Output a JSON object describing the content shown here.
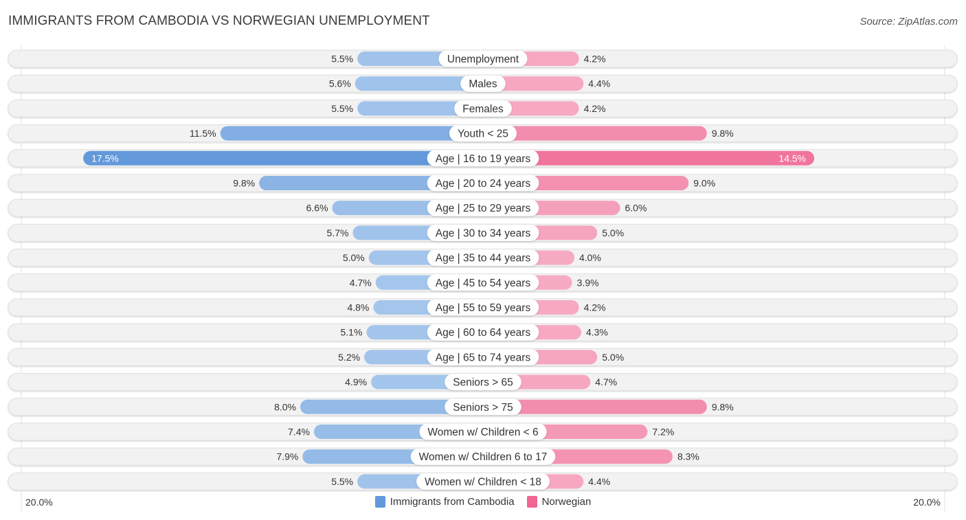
{
  "header": {
    "title": "IMMIGRANTS FROM CAMBODIA VS NORWEGIAN UNEMPLOYMENT",
    "source": "Source: ZipAtlas.com"
  },
  "colors": {
    "left_light": "#a9c9ed",
    "left_dark": "#6399db",
    "right_light": "#f6abc2",
    "right_dark": "#f06591",
    "row_bg": "#f2f2f2",
    "label_bg": "#ffffff"
  },
  "chart_data": {
    "type": "bar",
    "orientation": "horizontal-diverging",
    "title": "IMMIGRANTS FROM CAMBODIA VS NORWEGIAN UNEMPLOYMENT",
    "xlabel": "",
    "ylabel": "",
    "xlim": [
      -20,
      20
    ],
    "axis_min_label": "20.0%",
    "axis_max_label": "20.0%",
    "legend_position": "bottom",
    "categories": [
      "Unemployment",
      "Males",
      "Females",
      "Youth < 25",
      "Age | 16 to 19 years",
      "Age | 20 to 24 years",
      "Age | 25 to 29 years",
      "Age | 30 to 34 years",
      "Age | 35 to 44 years",
      "Age | 45 to 54 years",
      "Age | 55 to 59 years",
      "Age | 60 to 64 years",
      "Age | 65 to 74 years",
      "Seniors > 65",
      "Seniors > 75",
      "Women w/ Children < 6",
      "Women w/ Children 6 to 17",
      "Women w/ Children < 18"
    ],
    "series": [
      {
        "name": "Immigrants from Cambodia",
        "side": "left",
        "color": "#6399db",
        "values": [
          5.5,
          5.6,
          5.5,
          11.5,
          17.5,
          9.8,
          6.6,
          5.7,
          5.0,
          4.7,
          4.8,
          5.1,
          5.2,
          4.9,
          8.0,
          7.4,
          7.9,
          5.5
        ],
        "labels": [
          "5.5%",
          "5.6%",
          "5.5%",
          "11.5%",
          "17.5%",
          "9.8%",
          "6.6%",
          "5.7%",
          "5.0%",
          "4.7%",
          "4.8%",
          "5.1%",
          "5.2%",
          "4.9%",
          "8.0%",
          "7.4%",
          "7.9%",
          "5.5%"
        ]
      },
      {
        "name": "Norwegian",
        "side": "right",
        "color": "#f06591",
        "values": [
          4.2,
          4.4,
          4.2,
          9.8,
          14.5,
          9.0,
          6.0,
          5.0,
          4.0,
          3.9,
          4.2,
          4.3,
          5.0,
          4.7,
          9.8,
          7.2,
          8.3,
          4.4
        ],
        "labels": [
          "4.2%",
          "4.4%",
          "4.2%",
          "9.8%",
          "14.5%",
          "9.0%",
          "6.0%",
          "5.0%",
          "4.0%",
          "3.9%",
          "4.2%",
          "4.3%",
          "5.0%",
          "4.7%",
          "9.8%",
          "7.2%",
          "8.3%",
          "4.4%"
        ]
      }
    ]
  }
}
